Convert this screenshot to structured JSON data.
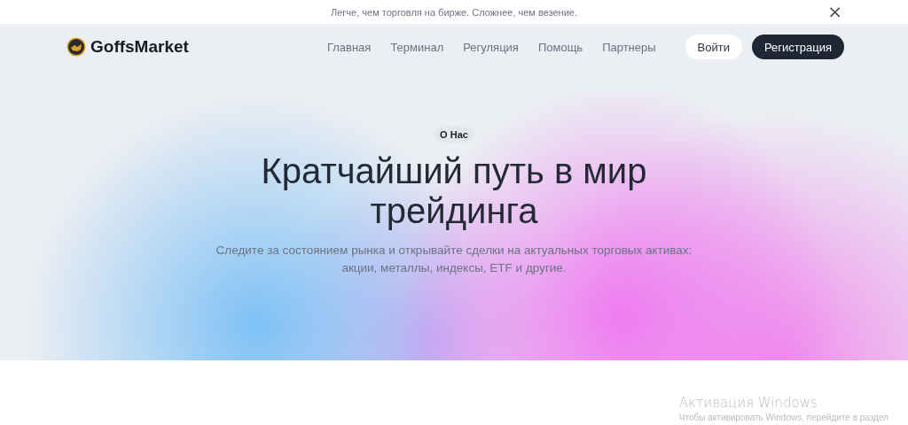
{
  "announcement": {
    "text": "Легче, чем торговля на бирже. Сложнее, чем везение.",
    "close": "×"
  },
  "header": {
    "logo": "GoffsMarket",
    "nav": [
      "Главная",
      "Терминал",
      "Регуляция",
      "Помощь",
      "Партнеры"
    ],
    "login": "Войти",
    "register": "Регистрация"
  },
  "hero": {
    "badge": "О Нас",
    "title": "Кратчайший путь в мир трейдинга",
    "subtitle": "Следите за состоянием рынка и открывайте сделки на актуальных торговых активах: акции, металлы, индексы, ETF и другие."
  },
  "os_notice": {
    "title": "Активация Windows",
    "text": "Чтобы активировать Windows, перейдите в раздел"
  }
}
